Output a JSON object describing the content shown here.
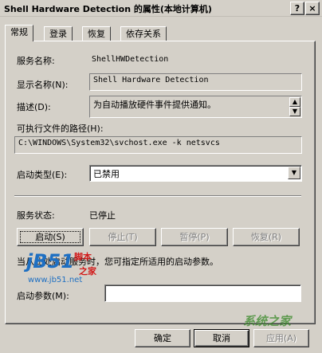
{
  "window": {
    "title": "Shell Hardware Detection 的属性(本地计算机)",
    "help_btn": "?",
    "close_btn": "×"
  },
  "tabs": [
    "常规",
    "登录",
    "恢复",
    "依存关系"
  ],
  "general": {
    "service_name_label": "服务名称:",
    "service_name_value": "ShellHWDetection",
    "display_name_label": "显示名称(N):",
    "display_name_value": "Shell Hardware Detection",
    "description_label": "描述(D):",
    "description_value": "为自动播放硬件事件提供通知。",
    "path_label": "可执行文件的路径(H):",
    "path_value": "C:\\WINDOWS\\System32\\svchost.exe -k netsvcs",
    "startup_type_label": "启动类型(E):",
    "startup_type_value": "已禁用",
    "status_label": "服务状态:",
    "status_value": "已停止",
    "start_btn": "启动(S)",
    "stop_btn": "停止(T)",
    "pause_btn": "暂停(P)",
    "resume_btn": "恢复(R)",
    "hint_text": "当从此处启动服务时，您可指定所适用的启动参数。",
    "params_label": "启动参数(M):",
    "params_value": ""
  },
  "footer": {
    "ok_btn": "确定",
    "cancel_btn": "取消",
    "apply_btn": "应用(A)"
  },
  "watermark": {
    "logo_jb": "jB51",
    "logo_cn1": "脚本",
    "logo_cn2": "之家",
    "url": "www.jb51.net",
    "corner_text": "系统之家"
  },
  "colors": {
    "dialog_bg": "#d4d0c8",
    "watermark_blue": "#1e6fc2",
    "watermark_red": "#d11a1a",
    "watermark_green": "#3a8a2a"
  }
}
